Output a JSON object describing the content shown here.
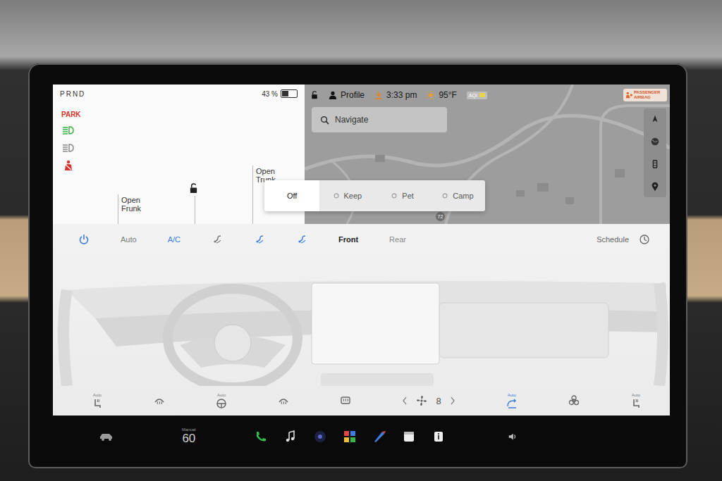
{
  "gear": {
    "label": "PRND"
  },
  "battery": {
    "percent": "43 %",
    "level": 0.43
  },
  "park": {
    "label": "PARK",
    "color": "#d9312b"
  },
  "indicators": [
    {
      "kind": "headlights",
      "color": "#3cb043"
    },
    {
      "kind": "auto-headlights",
      "color": "#8a8a8a"
    },
    {
      "kind": "seatbelt",
      "color": "#d9312b"
    }
  ],
  "car": {
    "frunk": {
      "action": "Open",
      "part": "Frunk"
    },
    "trunk": {
      "action": "Open",
      "part": "Trunk"
    },
    "locked": false
  },
  "status_bar": {
    "locked": false,
    "profile": "Profile",
    "time": "3:33 pm",
    "temperature": "95°F",
    "aqi": "AQI",
    "airbag": "PASSENGER AIRBAG"
  },
  "search": {
    "placeholder": "Navigate"
  },
  "map": {
    "route_marker": "72"
  },
  "modes": [
    {
      "label": "Off",
      "selected": true
    },
    {
      "label": "Keep",
      "selected": false
    },
    {
      "label": "Pet",
      "selected": false
    },
    {
      "label": "Camp",
      "selected": false
    }
  ],
  "climate": {
    "power_on": true,
    "toggles": [
      {
        "label": "Auto",
        "on": false
      },
      {
        "label": "A/C",
        "on": true
      }
    ],
    "airflow": [
      {
        "on": false
      },
      {
        "on": true
      },
      {
        "on": true
      }
    ],
    "zones": [
      {
        "label": "Front",
        "selected": true
      },
      {
        "label": "Rear",
        "selected": false
      }
    ],
    "schedule": "Schedule",
    "controls": [
      {
        "kind": "seat-heat",
        "label": "Auto",
        "on": false
      },
      {
        "kind": "wiper-defrost",
        "on": false
      },
      {
        "kind": "steering-heat",
        "label": "Auto",
        "on": false
      },
      {
        "kind": "front-defrost",
        "on": false
      },
      {
        "kind": "rear-defrost",
        "on": false
      },
      {
        "kind": "fan",
        "label": "8",
        "on": false
      },
      {
        "kind": "recirculate",
        "label": "Auto",
        "on": true
      },
      {
        "kind": "bioweapon",
        "on": false
      },
      {
        "kind": "seat-heat",
        "label": "Auto",
        "on": false
      }
    ]
  },
  "taskbar": {
    "speed_mode": "Manual",
    "speed": "60",
    "apps": [
      {
        "kind": "phone"
      },
      {
        "kind": "music"
      },
      {
        "kind": "camera"
      },
      {
        "kind": "launcher"
      },
      {
        "kind": "toybox"
      },
      {
        "kind": "calendar"
      },
      {
        "kind": "info"
      }
    ]
  }
}
